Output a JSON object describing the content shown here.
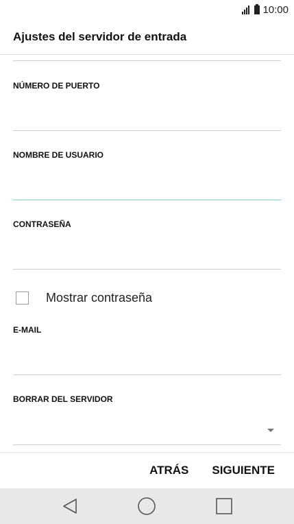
{
  "status_bar": {
    "time": "10:00",
    "signal_icon": "signal-icon",
    "battery_icon": "battery-icon"
  },
  "header": {
    "title": "Ajustes del servidor de entrada"
  },
  "fields": {
    "port": {
      "label": "NÚMERO DE PUERTO",
      "value": ""
    },
    "username": {
      "label": "NOMBRE DE USUARIO",
      "value": ""
    },
    "password": {
      "label": "CONTRASEÑA",
      "value": ""
    },
    "show_password": {
      "label": "Mostrar contraseña",
      "checked": false
    },
    "email": {
      "label": "E-MAIL",
      "value": ""
    },
    "delete_from_server": {
      "label": "BORRAR DEL SERVIDOR",
      "value": ""
    }
  },
  "buttons": {
    "back": "ATRÁS",
    "next": "SIGUIENTE"
  },
  "nav": {
    "back_icon": "nav-back-icon",
    "home_icon": "nav-home-icon",
    "recents_icon": "nav-recents-icon"
  },
  "colors": {
    "active_underline": "#7fd3c4",
    "nav_background": "#e8e8e8"
  }
}
